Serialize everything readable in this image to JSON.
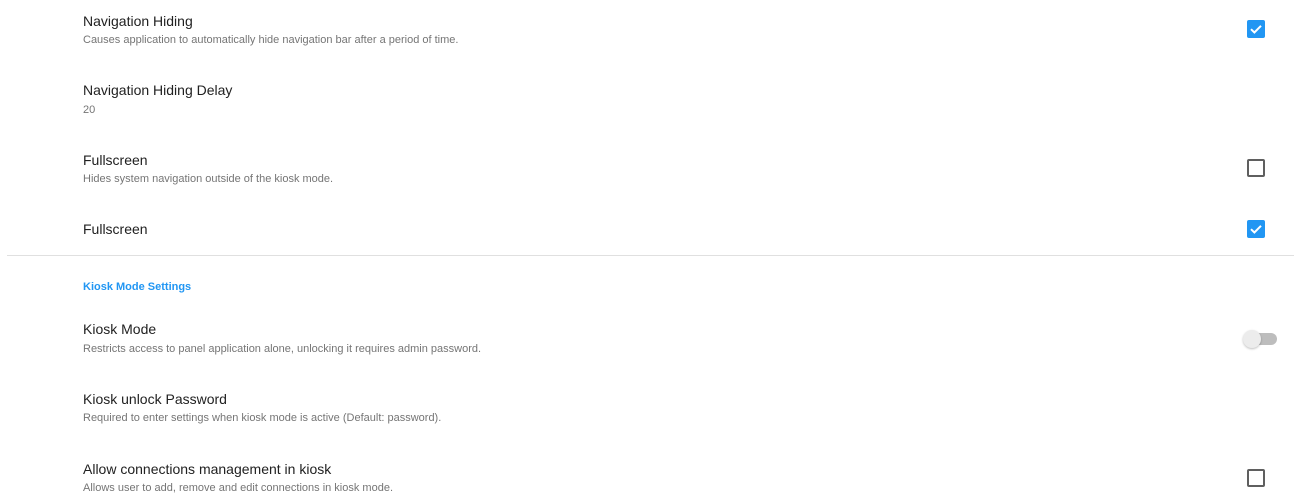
{
  "preferences": [
    {
      "title": "Navigation Hiding",
      "summary": "Causes application to automatically hide navigation bar after a period of time.",
      "control": "checkbox",
      "checked": true
    },
    {
      "title": "Navigation Hiding Delay",
      "summary": "20"
    },
    {
      "title": "Fullscreen",
      "summary": "Hides system navigation outside of the kiosk mode.",
      "control": "checkbox",
      "checked": false
    },
    {
      "title": "Fullscreen",
      "control": "checkbox",
      "checked": true
    }
  ],
  "kiosk_section": {
    "header": "Kiosk Mode Settings",
    "items": [
      {
        "title": "Kiosk Mode",
        "summary": "Restricts access to panel application alone, unlocking it requires admin password.",
        "control": "switch",
        "on": false
      },
      {
        "title": "Kiosk unlock Password",
        "summary": "Required to enter settings when kiosk mode is active (Default: password)."
      },
      {
        "title": "Allow connections management in kiosk",
        "summary": "Allows user to add, remove and edit connections in kiosk mode.",
        "control": "checkbox",
        "checked": false
      }
    ]
  },
  "colors": {
    "accent": "#2196f3",
    "title_text": "#212121",
    "summary_text": "#757575",
    "divider": "#e0e0e0"
  }
}
